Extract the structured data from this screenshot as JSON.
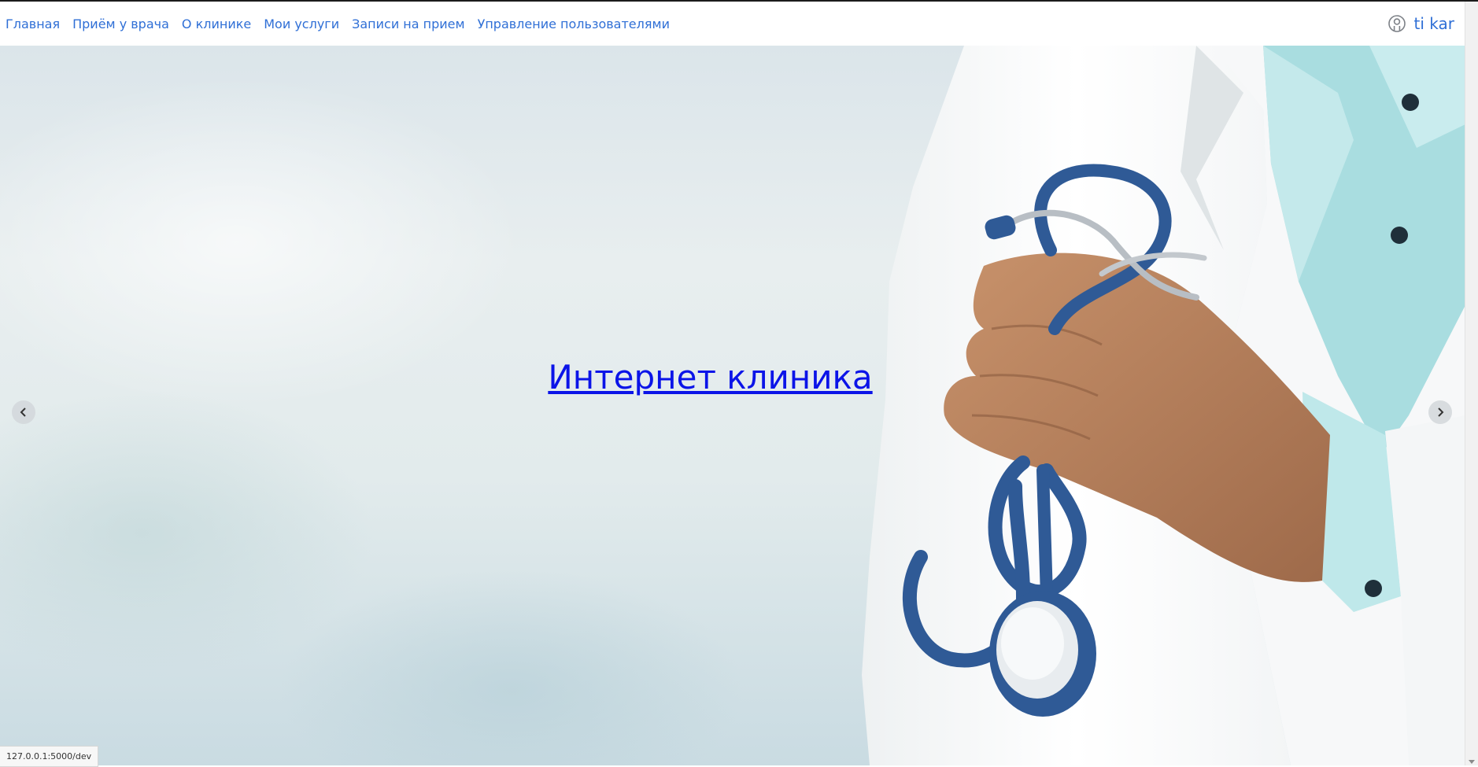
{
  "nav": {
    "links": [
      {
        "label": "Главная"
      },
      {
        "label": "Приём у врача"
      },
      {
        "label": "О клинике"
      },
      {
        "label": "Мои услуги"
      },
      {
        "label": "Записи на прием"
      },
      {
        "label": "Управление пользователями"
      }
    ],
    "user": {
      "icon": "user-circle-icon",
      "name": "ti kar"
    }
  },
  "hero": {
    "title": "Интернет клиника",
    "prev_icon": "chevron-left-icon",
    "next_icon": "chevron-right-icon"
  },
  "status_bar": {
    "url": "127.0.0.1:5000/dev"
  },
  "colors": {
    "link": "#2f6fd6",
    "hero_title": "#0b14e8"
  }
}
